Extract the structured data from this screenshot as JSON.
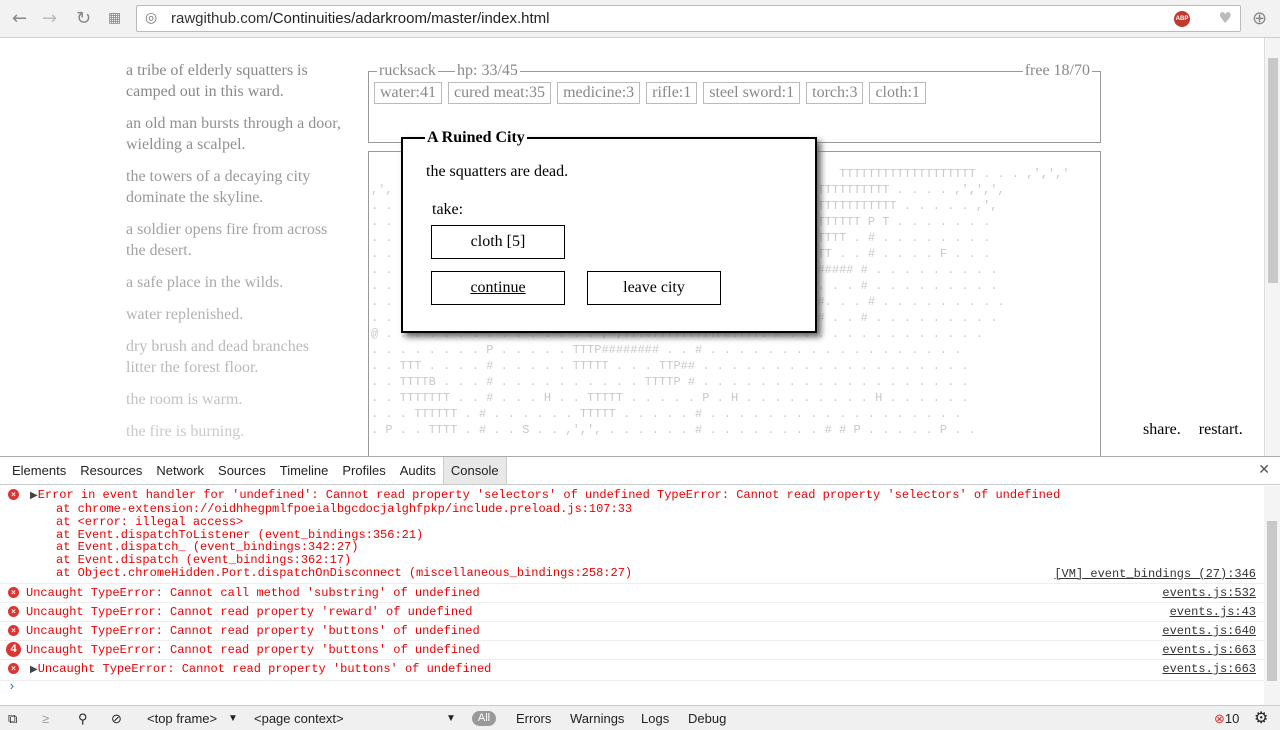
{
  "browser": {
    "url_host": "rawgithub.com",
    "url_path": "/Continuities/adarkroom/master/index.html",
    "abp_label": "ABP"
  },
  "notifications": [
    "a tribe of elderly squatters is camped out in this ward.",
    "an old man bursts through a door, wielding a scalpel.",
    "the towers of a decaying city dominate the skyline.",
    "a soldier opens fire from across the desert.",
    "a safe place in the wilds.",
    "water replenished.",
    "dry brush and dead branches litter the forest floor.",
    "the room is warm.",
    "the fire is burning."
  ],
  "rucksack": {
    "label": "rucksack",
    "hp": "hp: 33/45",
    "free": "free 18/70",
    "items": [
      "water:41",
      "cured meat:35",
      "medicine:3",
      "rifle:1",
      "steel sword:1",
      "torch:3",
      "cloth:1"
    ]
  },
  "event": {
    "title": "A Ruined City",
    "text": "the squatters are dead.",
    "take_label": "take:",
    "loot_button": "cloth [5]",
    "continue_button": "continue",
    "leave_button": "leave city"
  },
  "map_rows": [
    "                                                                 TTTTTTTTTTTTTTTTTTT . . . ,',','",
    ",',  . . . . . . . . . . . . . . . . . . . . . . . . TTTTTTTTTTTTTTTTTTT . . . . ,',',',",
    ". . . . . . . . . . . . . . . . . . . . . . . . . . TTTTTTTTTTTTTTTTTTTTT . . . . . ,',",
    ". . . . . . . . . . . . . . . . . . . . . . . . . . TTTTTTTTTTTTTTTT P T . . . . . . .",
    ". . . . . . . . . . . . . . . . . . . . . . . . . . TTTTTTTTTTTTTT . # . . . . . . . .",
    ". . . . . . . . . . . . . . . . . . . . . . . . . . TTTTTTTTTTTT . . # . . . . F . . .",
    ". . . . . . . . . . . . . . . . . . . . . . . . . . TTTTTTTTTP##### # . . . . . . . . .",
    ". . . . . . . . . . . . . . . . . . . . . . . . . . TTTTTTTTT#. . . # . . . . . . . . .",
    ". . . . . . . . . . . . . . . . . . . . . . . . . . TTTTTTTTM #. . . # . . . . . . . . .",
    ". . . . . . . . . . . . . . . . . . . . . . . . . . TTTTTTTT. # . . # . . . . . . . . .",
    "@ . . . . . . . . . . . . . . . ,',TTT#TTTTTTTTTP#TTTT. # . . . . . . . . . . . . . .",
    ". . . . . . . . P . . . . . TTTP######## . . # . . . . . . . . . . . . . . . . . .",
    ". . TTT . . . . # . . . . . TTTTT . . . TTP## . . . . . . . . . . . . . . . . . . .",
    ". . TTTTB . . . # . . . . . . . . . . TTTTP # . . . . . . . . . . . . . . . . . . .",
    ". . TTTTTTT . . # . . . H . . TTTTT . . . . . P . H . . . . . . . . . H . . . . . .",
    ". . . TTTTTT . # . . . . . . TTTTT . . . . . # . . . . . . . . . . . . . . . . . .",
    ". P . . TTTT . # . . S . . ,',', . . . . . . # . . . . . . . . # # P . . . . . P . ."
  ],
  "footer": {
    "share": "share.",
    "restart": "restart."
  },
  "devtools": {
    "tabs": [
      "Elements",
      "Resources",
      "Network",
      "Sources",
      "Timeline",
      "Profiles",
      "Audits",
      "Console"
    ],
    "active_tab": "Console",
    "first_error": {
      "text": "Error in event handler for 'undefined': Cannot read property 'selectors' of undefined TypeError: Cannot read property 'selectors' of undefined",
      "stack": [
        "at chrome-extension://oidhhegpmlfpoeialbgcdocjalghfpkp/include.preload.js:107:33",
        "at <error: illegal access>",
        "at Event.dispatchToListener (event_bindings:356:21)",
        "at Event.dispatch_ (event_bindings:342:27)",
        "at Event.dispatch (event_bindings:362:17)",
        "at Object.chromeHidden.Port.dispatchOnDisconnect (miscellaneous_bindings:258:27)"
      ],
      "source": "[VM] event_bindings (27):346"
    },
    "messages": [
      {
        "text": "Uncaught TypeError: Cannot call method 'substring' of undefined",
        "source": "events.js:532",
        "count": ""
      },
      {
        "text": "Uncaught TypeError: Cannot read property 'reward' of undefined",
        "source": "events.js:43",
        "count": ""
      },
      {
        "text": "Uncaught TypeError: Cannot read property 'buttons' of undefined",
        "source": "events.js:640",
        "count": ""
      },
      {
        "text": "Uncaught TypeError: Cannot read property 'buttons' of undefined",
        "source": "events.js:663",
        "count": "4"
      },
      {
        "text": "Uncaught TypeError: Cannot read property 'buttons' of undefined",
        "source": "events.js:663",
        "count": ""
      }
    ],
    "prompt": "›",
    "frame_select": "<top frame>",
    "context_select": "<page context>",
    "filters": [
      "All",
      "Errors",
      "Warnings",
      "Logs",
      "Debug"
    ],
    "error_count": "10"
  },
  "colors": {
    "error": "#e00000",
    "faded_text": "#888888"
  }
}
